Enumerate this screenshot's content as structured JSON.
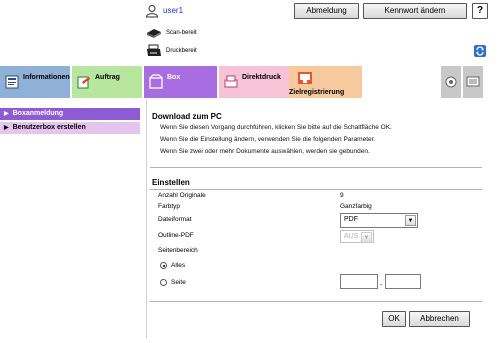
{
  "header": {
    "user": "user1",
    "logout_label": "Abmeldung",
    "password_label": "Kennwort ändern",
    "help_label": "?",
    "scan_status": "Scan-bereit",
    "print_status": "Druckbereit"
  },
  "tabs": [
    {
      "label": "Informationen",
      "icon": "info-book-icon"
    },
    {
      "label": "Auftrag",
      "icon": "job-icon"
    },
    {
      "label": "Box",
      "icon": "box-icon"
    },
    {
      "label": "Direktdruck",
      "icon": "direct-print-icon"
    },
    {
      "label": "Zielregistrierung",
      "icon": "destination-icon"
    }
  ],
  "sidebar": {
    "items": [
      {
        "label": "Boxanmeldung",
        "active": true
      },
      {
        "label": "Benutzerbox erstellen",
        "active": false
      }
    ]
  },
  "main": {
    "title": "Download zum PC",
    "descriptions": [
      "Wenn Sie diesen Vorgang durchführen, klicken Sie bitte auf die Schaltfläche OK.",
      "Wenn Sie die Einstellung ändern, verwenden Sie die folgenden Parameter.",
      "Wenn Sie zwei oder mehr Dokumente auswählen, werden sie gebunden."
    ],
    "settings_title": "Einstellen",
    "originals_label": "Anzahl Originale",
    "originals_value": "9",
    "color_label": "Farbtyp",
    "color_value": "Ganzfarbig",
    "format_label": "Dateiformat",
    "format_value": "PDF",
    "outline_label": "Outline-PDF",
    "outline_value": "AUS",
    "range_label": "Seitenbereich",
    "all_label": "Alles",
    "page_label": "Seite",
    "range_separator": "-",
    "ok_label": "OK",
    "cancel_label": "Abbrechen"
  },
  "colors": {
    "accent_purple": "#8e5bd6",
    "tab_info": "#8fb1d8",
    "tab_job": "#b7e6a0",
    "tab_box": "#a86de0",
    "tab_direct": "#f6c3d7",
    "tab_dest": "#f6c99e",
    "user_link": "#1a39c9"
  }
}
